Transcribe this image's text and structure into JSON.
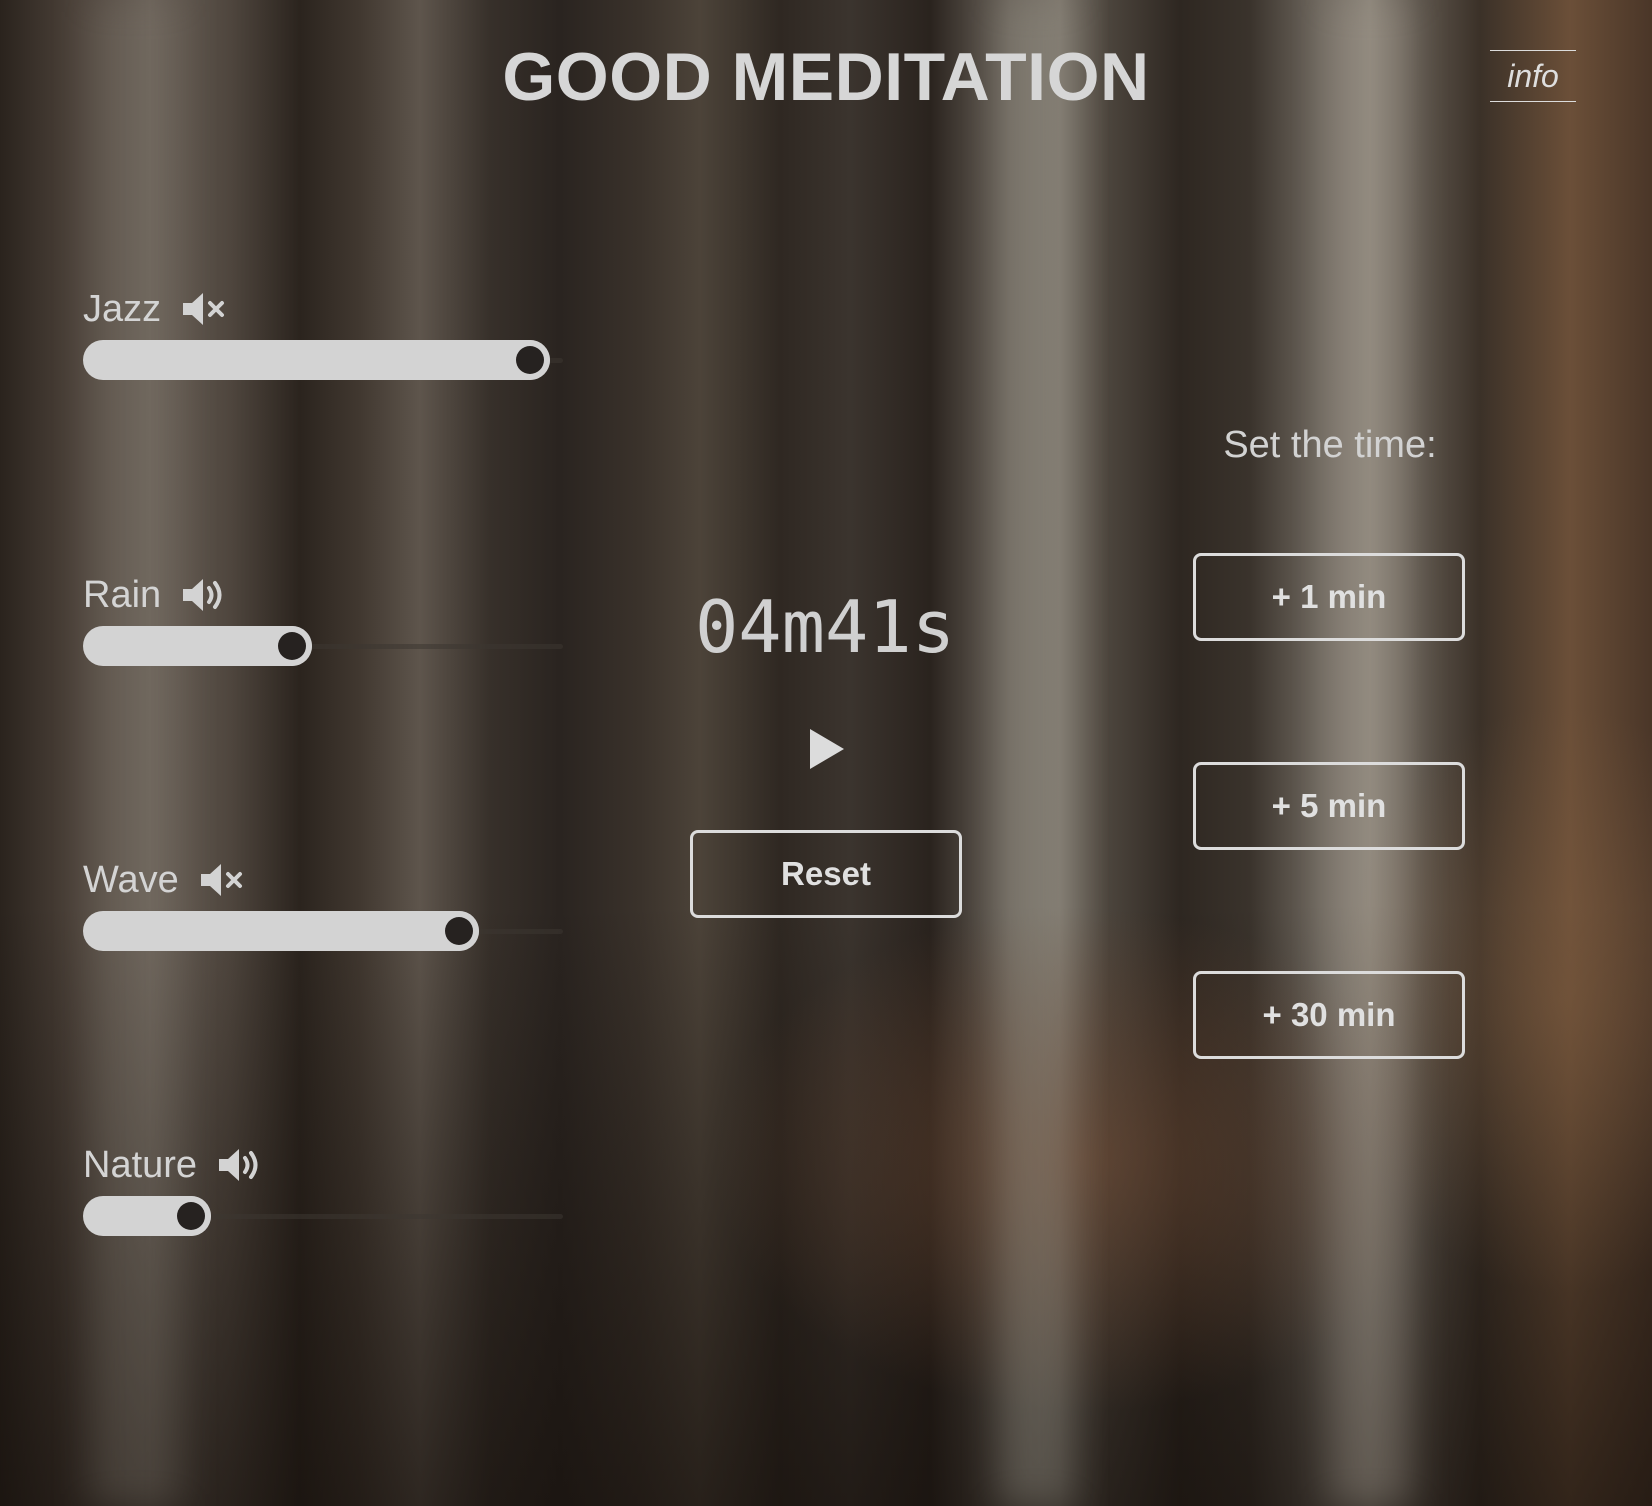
{
  "header": {
    "title": "GOOD MEDITATION",
    "info_label": "info"
  },
  "channels": [
    {
      "label": "Jazz",
      "icon": "speaker-muted-icon",
      "muted": true,
      "volume": 0.97
    },
    {
      "label": "Rain",
      "icon": "speaker-sound-icon",
      "muted": false,
      "volume": 0.43
    },
    {
      "label": "Wave",
      "icon": "speaker-muted-icon",
      "muted": true,
      "volume": 0.81
    },
    {
      "label": "Nature",
      "icon": "speaker-sound-icon",
      "muted": false,
      "volume": 0.2
    }
  ],
  "timer": {
    "display": "04m41s",
    "play_icon": "play-icon",
    "reset_label": "Reset"
  },
  "time_setter": {
    "label": "Set the time:",
    "buttons": [
      "+ 1 min",
      "+ 5 min",
      "+ 30 min"
    ]
  },
  "colors": {
    "text": "#d8d8d8",
    "slider_fill": "#d3d3d3",
    "slider_thumb_center": "#262220"
  }
}
